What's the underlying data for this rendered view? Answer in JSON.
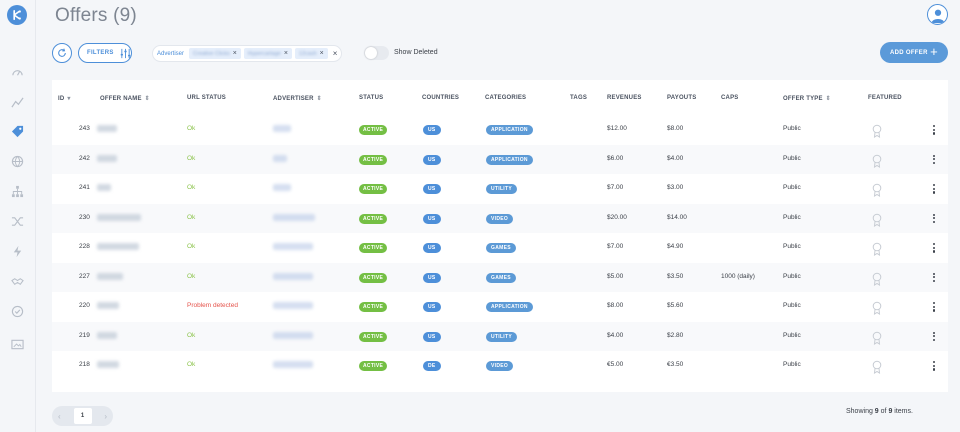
{
  "page": {
    "title": "Offers (9)"
  },
  "sidebar": {
    "items": [
      {
        "icon": "speedometer-icon"
      },
      {
        "icon": "chart-line-icon"
      },
      {
        "icon": "tag-icon",
        "active": true
      },
      {
        "icon": "globe-icon"
      },
      {
        "icon": "sitemap-icon"
      },
      {
        "icon": "shuffle-icon"
      },
      {
        "icon": "lightning-icon"
      },
      {
        "icon": "handshake-icon"
      },
      {
        "icon": "check-circle-icon"
      },
      {
        "icon": "image-icon"
      }
    ]
  },
  "toolbar": {
    "filters_label": "FILTERS",
    "filter_field_label": "Advertiser",
    "filter_chips": [
      "Creative Clicks",
      "Hypercartage",
      "12cash"
    ],
    "show_deleted_label": "Show Deleted",
    "show_deleted_on": false,
    "add_offer_label": "ADD OFFER",
    "add_offer_plus": "+"
  },
  "table": {
    "headers": {
      "id": "ID",
      "offer_name": "OFFER NAME",
      "url_status": "URL STATUS",
      "advertiser": "ADVERTISER",
      "status": "STATUS",
      "countries": "COUNTRIES",
      "categories": "CATEGORIES",
      "tags": "TAGS",
      "revenues": "REVENUES",
      "payouts": "PAYOUTS",
      "caps": "CAPS",
      "offer_type": "OFFER TYPE",
      "featured": "FEATURED"
    },
    "rows": [
      {
        "id": "243",
        "url_status": "Ok",
        "status": "ACTIVE",
        "country": "US",
        "category": "APPLICATION",
        "revenue": "$12.00",
        "payout": "$8.00",
        "caps": "",
        "offer_type": "Public"
      },
      {
        "id": "242",
        "url_status": "Ok",
        "status": "ACTIVE",
        "country": "US",
        "category": "APPLICATION",
        "revenue": "$6.00",
        "payout": "$4.00",
        "caps": "",
        "offer_type": "Public"
      },
      {
        "id": "241",
        "url_status": "Ok",
        "status": "ACTIVE",
        "country": "US",
        "category": "UTILITY",
        "revenue": "$7.00",
        "payout": "$3.00",
        "caps": "",
        "offer_type": "Public"
      },
      {
        "id": "230",
        "url_status": "Ok",
        "status": "ACTIVE",
        "country": "US",
        "category": "VIDEO",
        "revenue": "$20.00",
        "payout": "$14.00",
        "caps": "",
        "offer_type": "Public"
      },
      {
        "id": "228",
        "url_status": "Ok",
        "status": "ACTIVE",
        "country": "US",
        "category": "GAMES",
        "revenue": "$7.00",
        "payout": "$4.90",
        "caps": "",
        "offer_type": "Public"
      },
      {
        "id": "227",
        "url_status": "Ok",
        "status": "ACTIVE",
        "country": "US",
        "category": "GAMES",
        "revenue": "$5.00",
        "payout": "$3.50",
        "caps": "1000 (daily)",
        "offer_type": "Public"
      },
      {
        "id": "220",
        "url_status": "Problem detected",
        "status": "ACTIVE",
        "country": "US",
        "category": "APPLICATION",
        "revenue": "$8.00",
        "payout": "$5.60",
        "caps": "",
        "offer_type": "Public"
      },
      {
        "id": "219",
        "url_status": "Ok",
        "status": "ACTIVE",
        "country": "US",
        "category": "UTILITY",
        "revenue": "$4.00",
        "payout": "$2.80",
        "caps": "",
        "offer_type": "Public"
      },
      {
        "id": "218",
        "url_status": "Ok",
        "status": "ACTIVE",
        "country": "DE",
        "category": "VIDEO",
        "revenue": "€5.00",
        "payout": "€3.50",
        "caps": "",
        "offer_type": "Public"
      }
    ]
  },
  "pagination": {
    "prev": "‹",
    "current_page": "1",
    "next": "›",
    "showing_prefix": "Showing ",
    "showing_count": "9",
    "showing_mid": " of ",
    "showing_total": "9",
    "showing_suffix": " items."
  },
  "colors": {
    "accent": "#4d8fd9",
    "active_badge": "#74bf44",
    "ok_text": "#8bc34a",
    "error_text": "#e5534b"
  }
}
